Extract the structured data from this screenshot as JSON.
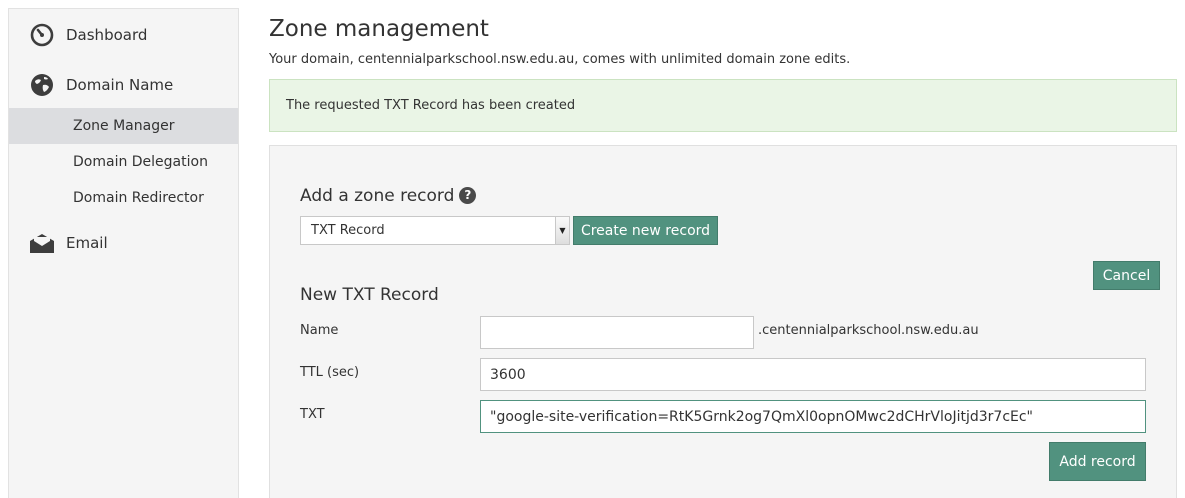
{
  "sidebar": {
    "dashboard": {
      "label": "Dashboard",
      "icon": "gauge-icon"
    },
    "domain_name": {
      "label": "Domain Name",
      "icon": "globe-icon"
    },
    "sub_items": [
      {
        "label": "Zone Manager",
        "active": true
      },
      {
        "label": "Domain Delegation",
        "active": false
      },
      {
        "label": "Domain Redirector",
        "active": false
      }
    ],
    "email": {
      "label": "Email",
      "icon": "envelope-icon"
    }
  },
  "main": {
    "title": "Zone management",
    "description": "Your domain, centennialparkschool.nsw.edu.au, comes with unlimited domain zone edits.",
    "alert": "The requested TXT Record has been created",
    "add_record": {
      "heading": "Add a zone record",
      "help_icon": "question-circle-icon",
      "select_value": "TXT Record",
      "create_button": "Create new record"
    },
    "cancel_button": "Cancel",
    "new_record": {
      "heading": "New TXT Record",
      "name_label": "Name",
      "name_value": "",
      "name_suffix": ".centennialparkschool.nsw.edu.au",
      "ttl_label": "TTL (sec)",
      "ttl_value": "3600",
      "txt_label": "TXT",
      "txt_value": "\"google-site-verification=RtK5Grnk2og7QmXl0opnOMwc2dCHrVloJitjd3r7cEc\"",
      "add_button": "Add record"
    }
  },
  "colors": {
    "accent": "#51927f",
    "alert_bg": "#eaf5e6",
    "sidebar_bg": "#f5f5f5",
    "active_item_bg": "#dcdde0"
  }
}
